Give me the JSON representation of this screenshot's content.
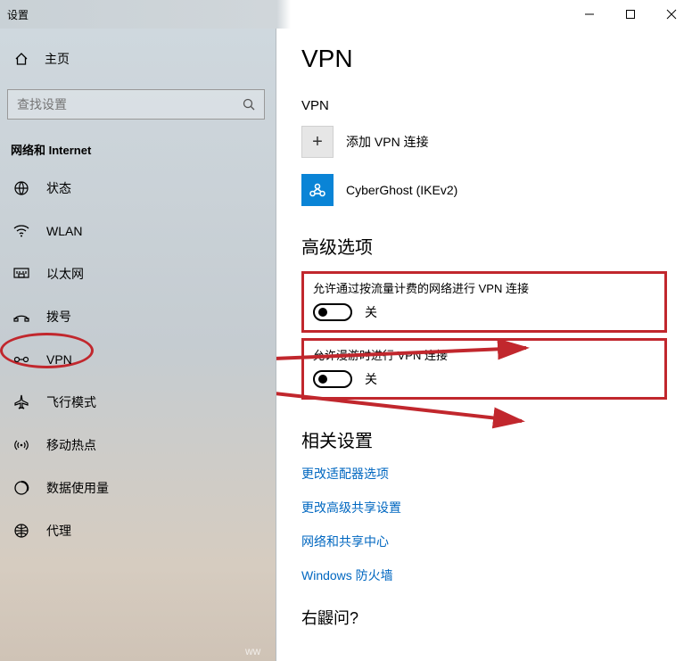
{
  "window": {
    "title": "设置"
  },
  "sidebar": {
    "home": "主页",
    "search_placeholder": "查找设置",
    "section": "网络和 Internet",
    "items": [
      {
        "label": "状态"
      },
      {
        "label": "WLAN"
      },
      {
        "label": "以太网"
      },
      {
        "label": "拨号"
      },
      {
        "label": "VPN"
      },
      {
        "label": "飞行模式"
      },
      {
        "label": "移动热点"
      },
      {
        "label": "数据使用量"
      },
      {
        "label": "代理"
      }
    ]
  },
  "main": {
    "title": "VPN",
    "sub": "VPN",
    "add_label": "添加 VPN 连接",
    "conn1": "CyberGhost (IKEv2)",
    "advanced_h": "高级选项",
    "toggle1_label": "允许通过按流量计费的网络进行 VPN 连接",
    "toggle2_label": "允许漫游时进行 VPN 连接",
    "toggle_off": "关",
    "related_h": "相关设置",
    "links": [
      "更改适配器选项",
      "更改高级共享设置",
      "网络和共享中心",
      "Windows 防火墙"
    ],
    "tail": "右鼹问?"
  }
}
